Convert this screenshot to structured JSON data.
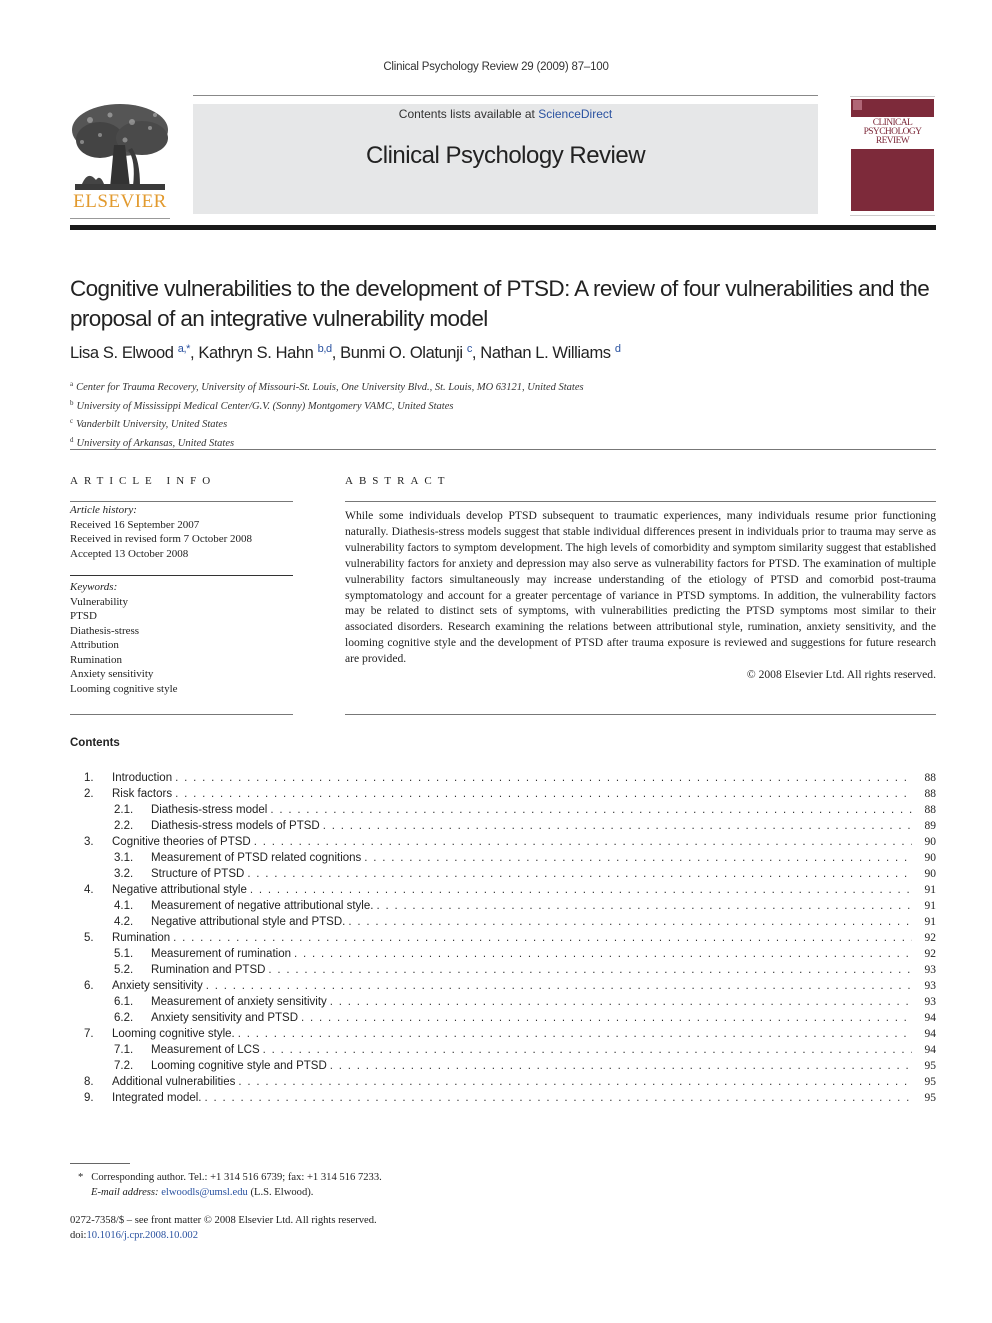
{
  "header": {
    "running_head": "Clinical Psychology Review 29 (2009) 87–100",
    "contents_available": "Contents lists available at ",
    "sciencedirect_link": "ScienceDirect",
    "journal_title": "Clinical Psychology Review",
    "publisher_logo_text": "ELSEVIER",
    "cover_title_lines": [
      "CLINICAL",
      "PSYCHOLOGY",
      "REVIEW"
    ]
  },
  "colors": {
    "link": "#2a52a0",
    "elsevier_orange": "#e29a2e",
    "cover_maroon": "#7d2a3a",
    "masthead_gray": "#e6e7e8"
  },
  "article": {
    "title": "Cognitive vulnerabilities to the development of PTSD: A review of four vulnerabilities and the proposal of an integrative vulnerability model",
    "authors": [
      {
        "name": "Lisa S. Elwood",
        "sup": "a,*"
      },
      {
        "name": "Kathryn S. Hahn",
        "sup": "b,d"
      },
      {
        "name": "Bunmi O. Olatunji",
        "sup": "c"
      },
      {
        "name": "Nathan L. Williams",
        "sup": "d"
      }
    ],
    "affiliations": [
      {
        "key": "a",
        "text": "Center for Trauma Recovery, University of Missouri-St. Louis, One University Blvd., St. Louis, MO 63121, United States"
      },
      {
        "key": "b",
        "text": "University of Mississippi Medical Center/G.V. (Sonny) Montgomery VAMC, United States"
      },
      {
        "key": "c",
        "text": "Vanderbilt University, United States"
      },
      {
        "key": "d",
        "text": "University of Arkansas, United States"
      }
    ]
  },
  "article_info": {
    "heading": "ARTICLE INFO",
    "history_label": "Article history:",
    "history": [
      "Received 16 September 2007",
      "Received in revised form 7 October 2008",
      "Accepted 13 October 2008"
    ],
    "keywords_label": "Keywords:",
    "keywords": [
      "Vulnerability",
      "PTSD",
      "Diathesis-stress",
      "Attribution",
      "Rumination",
      "Anxiety sensitivity",
      "Looming cognitive style"
    ]
  },
  "abstract": {
    "heading": "ABSTRACT",
    "text": "While some individuals develop PTSD subsequent to traumatic experiences, many individuals resume prior functioning naturally. Diathesis-stress models suggest that stable individual differences present in individuals prior to trauma may serve as vulnerability factors to symptom development. The high levels of comorbidity and symptom similarity suggest that established vulnerability factors for anxiety and depression may also serve as vulnerability factors for PTSD. The examination of multiple vulnerability factors simultaneously may increase understanding of the etiology of PTSD and comorbid post-trauma symptomatology and account for a greater percentage of variance in PTSD symptoms. In addition, the vulnerability factors may be related to distinct sets of symptoms, with vulnerabilities predicting the PTSD symptoms most similar to their associated disorders. Research examining the relations between attributional style, rumination, anxiety sensitivity, and the looming cognitive style and the development of PTSD after trauma exposure is reviewed and suggestions for future research are provided.",
    "copyright": "© 2008 Elsevier Ltd. All rights reserved."
  },
  "contents": {
    "heading": "Contents",
    "items": [
      {
        "num": "1.",
        "title": "Introduction",
        "page": "88",
        "level": 1
      },
      {
        "num": "2.",
        "title": "Risk factors",
        "page": "88",
        "level": 1
      },
      {
        "num": "2.1.",
        "title": "Diathesis-stress model",
        "page": "88",
        "level": 2
      },
      {
        "num": "2.2.",
        "title": "Diathesis-stress models of PTSD",
        "page": "89",
        "level": 2
      },
      {
        "num": "3.",
        "title": "Cognitive theories of PTSD",
        "page": "90",
        "level": 1
      },
      {
        "num": "3.1.",
        "title": "Measurement of PTSD related cognitions",
        "page": "90",
        "level": 2
      },
      {
        "num": "3.2.",
        "title": "Structure of PTSD",
        "page": "90",
        "level": 2
      },
      {
        "num": "4.",
        "title": "Negative attributional style",
        "page": "91",
        "level": 1
      },
      {
        "num": "4.1.",
        "title": "Measurement of negative attributional style.",
        "page": "91",
        "level": 2
      },
      {
        "num": "4.2.",
        "title": "Negative attributional style and PTSD.",
        "page": "91",
        "level": 2
      },
      {
        "num": "5.",
        "title": "Rumination",
        "page": "92",
        "level": 1
      },
      {
        "num": "5.1.",
        "title": "Measurement of rumination",
        "page": "92",
        "level": 2
      },
      {
        "num": "5.2.",
        "title": "Rumination and PTSD",
        "page": "93",
        "level": 2
      },
      {
        "num": "6.",
        "title": "Anxiety sensitivity",
        "page": "93",
        "level": 1
      },
      {
        "num": "6.1.",
        "title": "Measurement of anxiety sensitivity",
        "page": "93",
        "level": 2
      },
      {
        "num": "6.2.",
        "title": "Anxiety sensitivity and PTSD",
        "page": "94",
        "level": 2
      },
      {
        "num": "7.",
        "title": "Looming cognitive style.",
        "page": "94",
        "level": 1
      },
      {
        "num": "7.1.",
        "title": "Measurement of LCS",
        "page": "94",
        "level": 2
      },
      {
        "num": "7.2.",
        "title": "Looming cognitive style and PTSD",
        "page": "95",
        "level": 2
      },
      {
        "num": "8.",
        "title": "Additional vulnerabilities",
        "page": "95",
        "level": 1
      },
      {
        "num": "9.",
        "title": "Integrated model.",
        "page": "95",
        "level": 1
      }
    ]
  },
  "footnote": {
    "marker": "*",
    "corresponding": "Corresponding author. Tel.: +1 314 516 6739; fax: +1 314 516 7233.",
    "email_label": "E-mail address:",
    "email": "elwoodls@umsl.edu",
    "email_suffix": "(L.S. Elwood)."
  },
  "front_matter": {
    "issn_line": "0272-7358/$ – see front matter © 2008 Elsevier Ltd. All rights reserved.",
    "doi_label": "doi:",
    "doi": "10.1016/j.cpr.2008.10.002"
  }
}
